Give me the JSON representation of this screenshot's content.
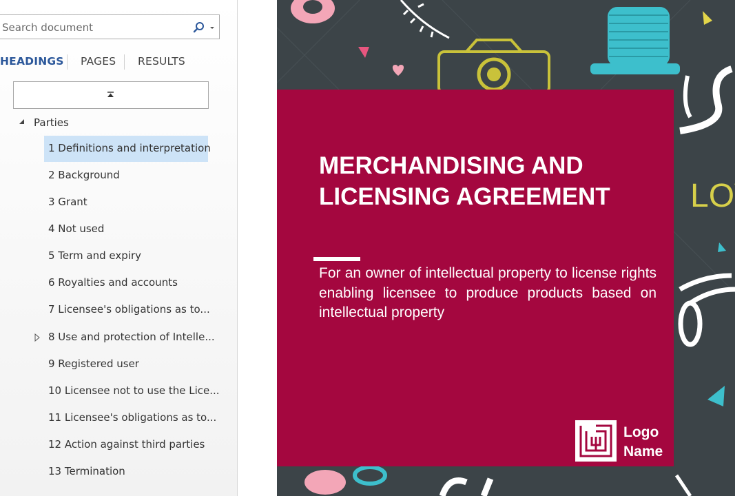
{
  "nav": {
    "search_placeholder": "Search document",
    "tabs": {
      "headings": "HEADINGS",
      "pages": "PAGES",
      "results": "RESULTS"
    },
    "parent_heading": "Parties",
    "headings": [
      "1 Definitions and interpretation",
      "2 Background",
      "3 Grant",
      "4 Not used",
      "5 Term and expiry",
      "6 Royalties and accounts",
      "7 Licensee's obligations as to...",
      "8 Use and protection of Intelle...",
      "9 Registered user",
      "10 Licensee not to use the Lice...",
      "11 Licensee's obligations as to...",
      "12 Action against third parties",
      "13 Termination"
    ],
    "active_heading_index": 0
  },
  "document": {
    "title": "MERCHANDISING AND LICENSING AGREEMENT",
    "subtitle": "For an owner of intellectual property to license rights enabling licensee to produce products based on intellectual property",
    "logo_text": "Logo Name",
    "background_text": "LOV",
    "colors": {
      "cover_box": "#a4073f",
      "page_background": "#3c4448",
      "active_heading": "#cde3f7",
      "active_tab": "#2b579a"
    }
  }
}
